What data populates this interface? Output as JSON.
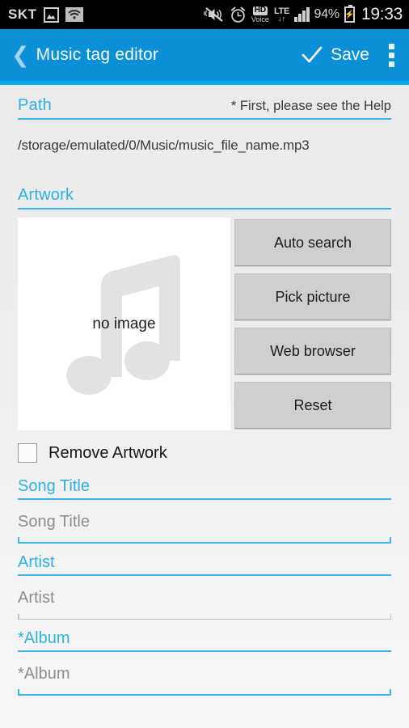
{
  "statusbar": {
    "carrier": "SKT",
    "gallery_icon": "image-icon",
    "wifi_icon": "wifi-icon",
    "mute_icon": "vibrate-off-icon",
    "alarm_icon": "alarm-clock-icon",
    "hd_label": "HD",
    "hd_sub": "Voice",
    "lte_label": "LTE",
    "lte_arrows": "↓↑",
    "signal_icon": "signal-bars-icon",
    "battery_percent": "94%",
    "battery_icon": "battery-charging-icon",
    "clock": "19:33"
  },
  "appbar": {
    "back_icon": "back-chevron-icon",
    "title": "Music tag editor",
    "check_icon": "checkmark-icon",
    "save_label": "Save",
    "overflow_icon": "overflow-menu-icon"
  },
  "path_section": {
    "title": "Path",
    "note": "* First, please see the Help",
    "value": "/storage/emulated/0/Music/music_file_name.mp3"
  },
  "artwork_section": {
    "title": "Artwork",
    "placeholder_text": "no image",
    "note_icon": "music-note-icon",
    "buttons": [
      {
        "label": "Auto search",
        "name": "auto-search-button"
      },
      {
        "label": "Pick picture",
        "name": "pick-picture-button"
      },
      {
        "label": "Web browser",
        "name": "web-browser-button"
      },
      {
        "label": "Reset",
        "name": "reset-button"
      }
    ],
    "remove_checkbox_label": "Remove Artwork",
    "remove_checkbox_checked": false
  },
  "fields": [
    {
      "label": "Song Title",
      "value": "",
      "placeholder": "Song Title",
      "focused": true
    },
    {
      "label": "Artist",
      "value": "",
      "placeholder": "Artist",
      "focused": false
    },
    {
      "label": "*Album",
      "value": "",
      "placeholder": "*Album",
      "focused": true
    }
  ],
  "colors": {
    "appbar_blue": "#0b8fd6",
    "accent_blue": "#3db5e8",
    "label_blue": "#2cb2e8",
    "underline_strip": "#03a9f4",
    "button_gray": "#cfcfcf",
    "page_bg": "#ededed"
  }
}
